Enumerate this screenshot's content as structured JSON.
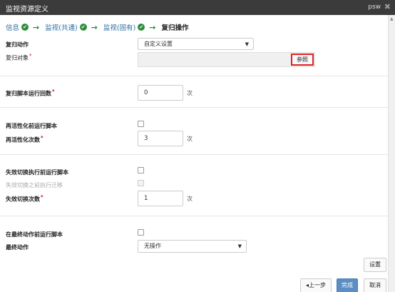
{
  "window": {
    "title": "监视资源定义",
    "user": "psw",
    "close": "✖"
  },
  "steps": [
    {
      "label": "信息",
      "done": true
    },
    {
      "label": "监视(共通)",
      "done": true
    },
    {
      "label": "监视(固有)",
      "done": true
    },
    {
      "label": "复归操作",
      "done": false
    }
  ],
  "step_arrow": "→",
  "step_check": "✔",
  "recovery_action": {
    "label": "复归动作",
    "value": "自定义设置"
  },
  "recovery_target": {
    "label": "复归对象",
    "browse": "参照"
  },
  "script_count": {
    "label": "复归脚本运行回数",
    "value": "0",
    "unit": "次"
  },
  "reactivation": {
    "script_label": "再活性化前运行脚本",
    "count_label": "再活性化次数",
    "count_value": "3",
    "unit": "次"
  },
  "failover": {
    "script_label": "失效切换执行前运行脚本",
    "migrate_label": "失效切换之前执行迁移",
    "count_label": "失效切换次数",
    "count_value": "1",
    "unit": "次"
  },
  "final": {
    "script_label": "在最终动作前运行脚本",
    "action_label": "最终动作",
    "action_value": "无操作"
  },
  "buttons": {
    "settings": "设置",
    "back": "◂上一步",
    "finish": "完成",
    "cancel": "取消"
  },
  "required_mark": "*",
  "caret": "▼"
}
